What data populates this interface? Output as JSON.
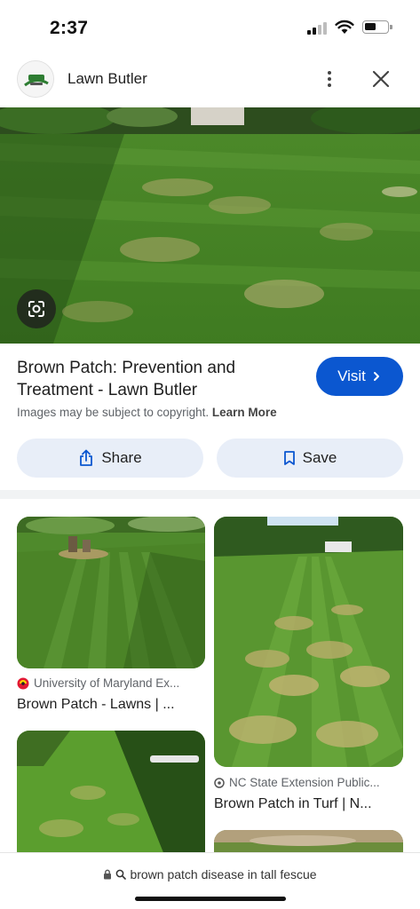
{
  "status_bar": {
    "time": "2:37"
  },
  "header": {
    "site_name": "Lawn Butler",
    "logo_text": "LAWN BUTLER"
  },
  "result": {
    "title": "Brown Patch: Prevention and Treatment - Lawn Butler",
    "visit_label": "Visit",
    "copyright_text": "Images may be subject to copyright.",
    "learn_more": "Learn More",
    "share_label": "Share",
    "save_label": "Save"
  },
  "related": [
    {
      "source": "University of Maryland Ex...",
      "title": "Brown Patch - Lawns | ..."
    },
    {
      "source": "NC State Extension Public...",
      "title": "Brown Patch in Turf | N..."
    }
  ],
  "search": {
    "query": "brown patch disease in tall fescue"
  },
  "colors": {
    "accent": "#0b57d0",
    "chip_bg": "#e8eef8",
    "grass": "#4f8a2c"
  }
}
